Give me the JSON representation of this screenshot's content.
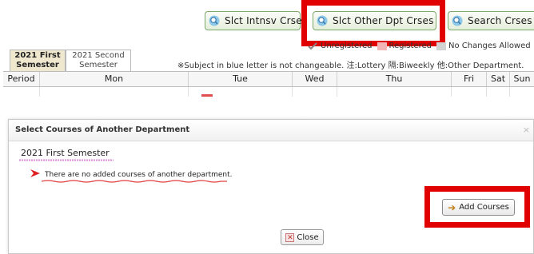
{
  "toolbar": {
    "intensive_label": "Slct Intnsv Crse",
    "other_dept_label": "Slct Other Dpt Crses",
    "search_label": "Search Crses"
  },
  "semester_tabs": {
    "first_line1": "2021 First",
    "first_line2": "Semester",
    "second_line1": "2021 Second",
    "second_line2": "Semester"
  },
  "legend": {
    "unregistered": "Unregistered",
    "registered": "Registered",
    "no_changes": "No Changes Allowed",
    "colors": {
      "unregistered": "#ffffff",
      "registered": "#f3b6b6",
      "no_changes": "#d3d3d3"
    }
  },
  "note": "※Subject in blue letter is not changeable. 注:Lottery 隔:Biweekly 他:Other Department.",
  "timetable_headers": [
    "Period",
    "Mon",
    "Tue",
    "Wed",
    "Thu",
    "Fri",
    "Sat",
    "Sun"
  ],
  "modal": {
    "title": "Select Courses of Another Department",
    "close_x": "×",
    "semester_title": "2021 First Semester",
    "message": "There are no added courses of another department.",
    "add_button": "Add Courses",
    "close_button": "Close"
  },
  "colors": {
    "highlight_red": "#e00000",
    "button_border_green": "#7aa76a",
    "active_tab": "#efe8cf"
  },
  "icons": {
    "toolbar": "magnifier-icon",
    "warning": "warning-icon",
    "add": "arrow-right-icon",
    "close": "close-icon"
  }
}
